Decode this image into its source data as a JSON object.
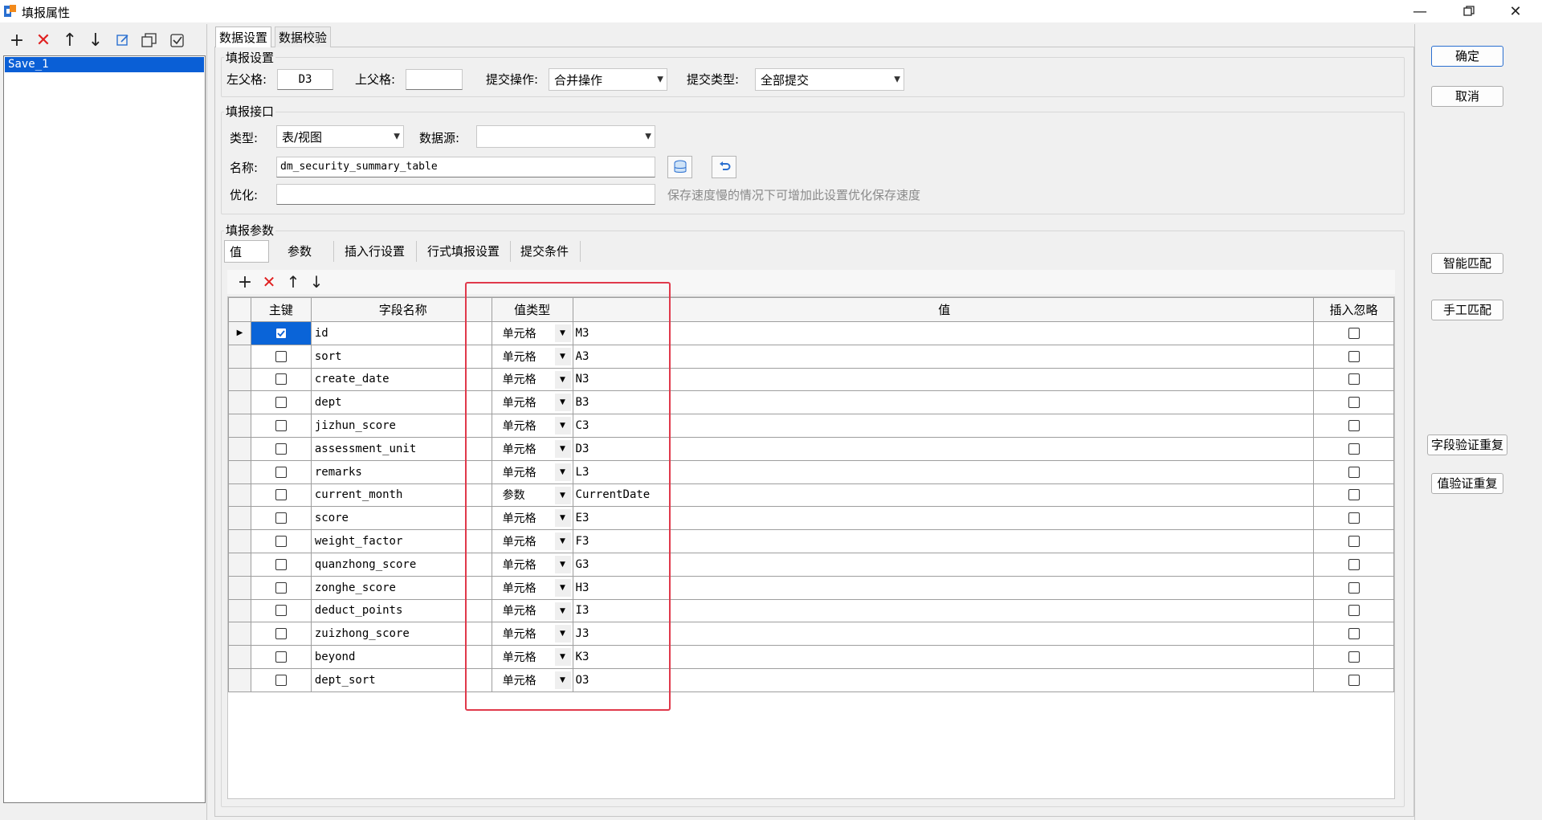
{
  "window": {
    "title": "填报属性",
    "controls": [
      "minimize",
      "restore",
      "close"
    ]
  },
  "left_toolbar": {
    "icons": [
      "add-icon",
      "delete-icon",
      "move-up-icon",
      "move-down-icon",
      "edit-icon",
      "copy-icon",
      "check-icon"
    ]
  },
  "save_list": {
    "items": [
      "Save_1"
    ],
    "selected": "Save_1"
  },
  "tabs": [
    "数据设置",
    "数据校验"
  ],
  "fill_settings": {
    "title": "填报设置",
    "left_parent_label": "左父格:",
    "left_parent_value": "D3",
    "top_parent_label": "上父格:",
    "top_parent_value": "",
    "submit_op_label": "提交操作:",
    "submit_op_value": "合并操作",
    "submit_type_label": "提交类型:",
    "submit_type_value": "全部提交"
  },
  "fill_interface": {
    "title": "填报接口",
    "type_label": "类型:",
    "type_value": "表/视图",
    "datasource_label": "数据源:",
    "datasource_value": "",
    "name_label": "名称:",
    "name_value": "dm_security_summary_table",
    "optimize_label": "优化:",
    "optimize_value": "",
    "optimize_hint": "保存速度慢的情况下可增加此设置优化保存速度"
  },
  "fill_params": {
    "title": "填报参数",
    "subtabs": [
      "值",
      "参数",
      "插入行设置",
      "行式填报设置",
      "提交条件"
    ],
    "grid_toolbar_icons": [
      "add-icon",
      "delete-icon",
      "move-up-icon",
      "move-down-icon"
    ],
    "columns": [
      "主键",
      "字段名称",
      "值类型",
      "值",
      "插入忽略"
    ],
    "rows": [
      {
        "key": true,
        "field": "id",
        "type": "单元格",
        "value": "M3",
        "ignore": false
      },
      {
        "key": false,
        "field": "sort",
        "type": "单元格",
        "value": "A3",
        "ignore": false
      },
      {
        "key": false,
        "field": "create_date",
        "type": "单元格",
        "value": "N3",
        "ignore": false
      },
      {
        "key": false,
        "field": "dept",
        "type": "单元格",
        "value": "B3",
        "ignore": false
      },
      {
        "key": false,
        "field": "jizhun_score",
        "type": "单元格",
        "value": "C3",
        "ignore": false
      },
      {
        "key": false,
        "field": "assessment_unit",
        "type": "单元格",
        "value": "D3",
        "ignore": false
      },
      {
        "key": false,
        "field": "remarks",
        "type": "单元格",
        "value": "L3",
        "ignore": false
      },
      {
        "key": false,
        "field": "current_month",
        "type": "参数",
        "value": "CurrentDate",
        "ignore": false
      },
      {
        "key": false,
        "field": "score",
        "type": "单元格",
        "value": "E3",
        "ignore": false
      },
      {
        "key": false,
        "field": "weight_factor",
        "type": "单元格",
        "value": "F3",
        "ignore": false
      },
      {
        "key": false,
        "field": "quanzhong_score",
        "type": "单元格",
        "value": "G3",
        "ignore": false
      },
      {
        "key": false,
        "field": "zonghe_score",
        "type": "单元格",
        "value": "H3",
        "ignore": false
      },
      {
        "key": false,
        "field": "deduct_points",
        "type": "单元格",
        "value": "I3",
        "ignore": false
      },
      {
        "key": false,
        "field": "zuizhong_score",
        "type": "单元格",
        "value": "J3",
        "ignore": false
      },
      {
        "key": false,
        "field": "beyond",
        "type": "单元格",
        "value": "K3",
        "ignore": false
      },
      {
        "key": false,
        "field": "dept_sort",
        "type": "单元格",
        "value": "O3",
        "ignore": false
      }
    ]
  },
  "right_buttons": {
    "ok": "确定",
    "cancel": "取消",
    "smart_match": "智能匹配",
    "manual_match": "手工匹配",
    "field_verify_dup": "字段验证重复",
    "value_verify_dup": "值验证重复"
  },
  "colors": {
    "selection": "#0a5fd6",
    "highlight": "#e0394b",
    "delete_icon": "#e02020"
  }
}
